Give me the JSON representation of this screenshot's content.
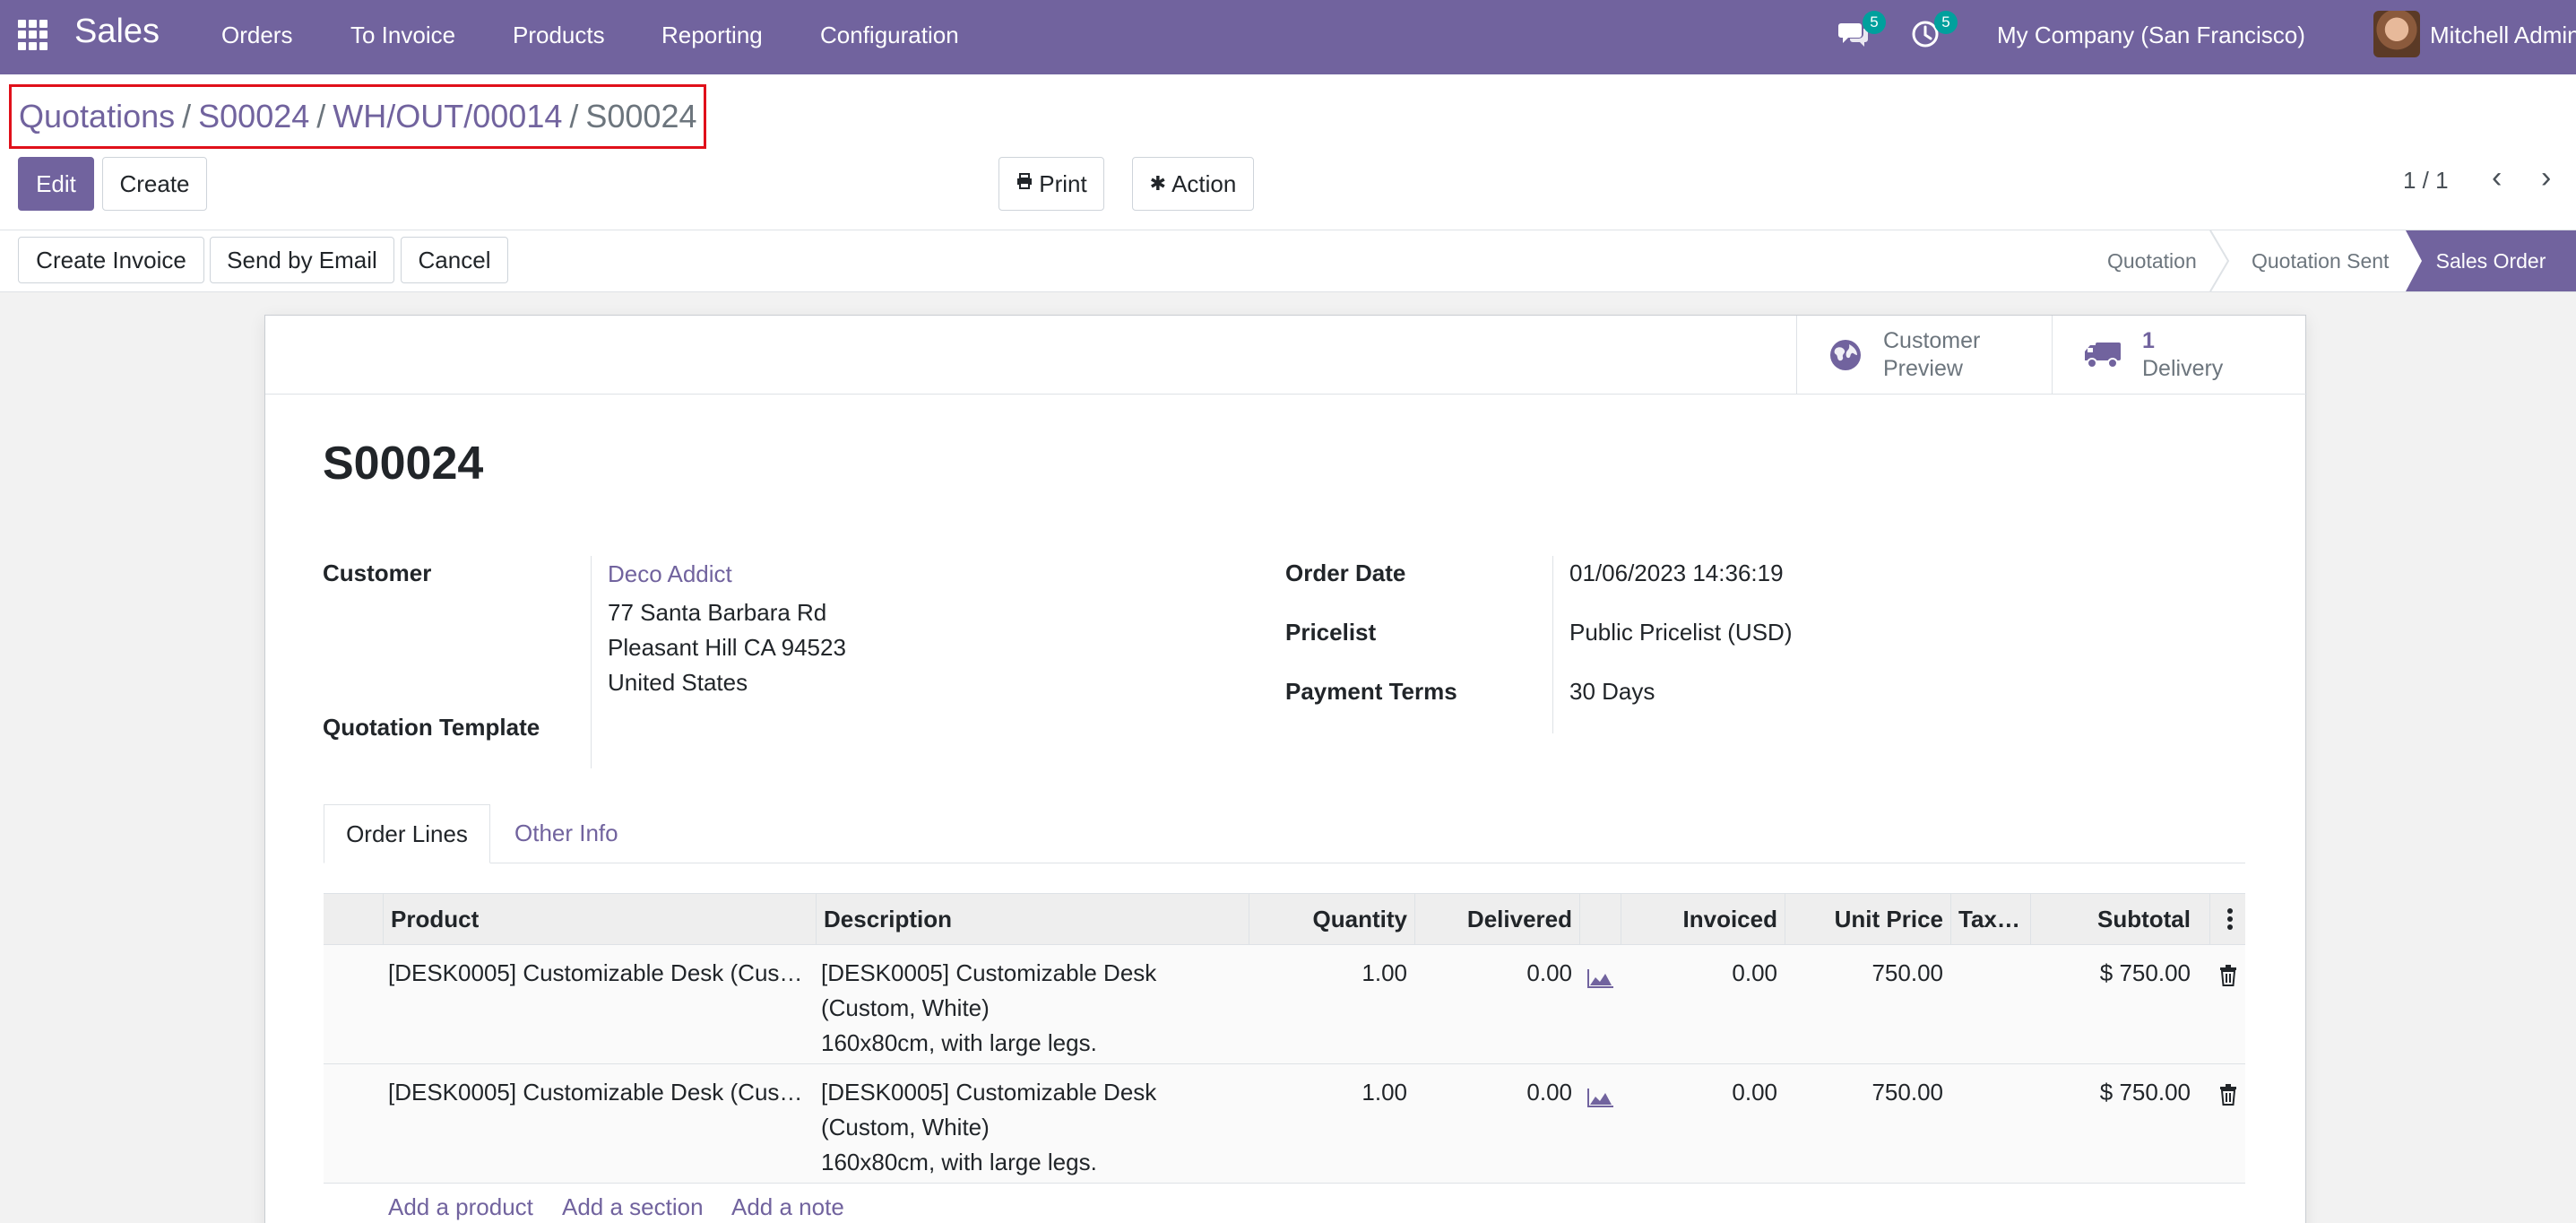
{
  "navbar": {
    "brand": "Sales",
    "menu": [
      "Orders",
      "To Invoice",
      "Products",
      "Reporting",
      "Configuration"
    ],
    "messages_badge": "5",
    "activities_badge": "5",
    "company": "My Company (San Francisco)",
    "user": "Mitchell Admin"
  },
  "breadcrumb": {
    "items": [
      "Quotations",
      "S00024",
      "WH/OUT/00014"
    ],
    "separator": "/",
    "current": "S00024"
  },
  "toolbar": {
    "edit_label": "Edit",
    "create_label": "Create",
    "print_label": "Print",
    "action_label": "Action",
    "pager": "1 / 1"
  },
  "statusbar": {
    "actions": [
      "Create Invoice",
      "Send by Email",
      "Cancel"
    ],
    "stages": [
      "Quotation",
      "Quotation Sent"
    ],
    "active_stage": "Sales Order"
  },
  "smart_buttons": {
    "preview_line1": "Customer",
    "preview_line2": "Preview",
    "delivery_count": "1",
    "delivery_label": "Delivery"
  },
  "form": {
    "title": "S00024",
    "customer_label": "Customer",
    "customer_name": "Deco Addict",
    "address_line1": "77 Santa Barbara Rd",
    "address_line2": "Pleasant Hill CA 94523",
    "address_line3": "United States",
    "template_label": "Quotation Template",
    "order_date_label": "Order Date",
    "order_date": "01/06/2023 14:36:19",
    "pricelist_label": "Pricelist",
    "pricelist": "Public Pricelist (USD)",
    "payment_terms_label": "Payment Terms",
    "payment_terms": "30 Days"
  },
  "tabs": {
    "active": "Order Lines",
    "other": "Other Info"
  },
  "table": {
    "headers": {
      "product": "Product",
      "description": "Description",
      "quantity": "Quantity",
      "delivered": "Delivered",
      "invoiced": "Invoiced",
      "unit_price": "Unit Price",
      "taxes": "Tax…",
      "subtotal": "Subtotal"
    },
    "rows": [
      {
        "product": "[DESK0005] Customizable Desk (Cus…",
        "desc1": "[DESK0005] Customizable Desk",
        "desc2": "(Custom, White)",
        "desc3": "160x80cm, with large legs.",
        "quantity": "1.00",
        "delivered": "0.00",
        "invoiced": "0.00",
        "unit_price": "750.00",
        "subtotal": "$ 750.00"
      },
      {
        "product": "[DESK0005] Customizable Desk (Cus…",
        "desc1": "[DESK0005] Customizable Desk",
        "desc2": "(Custom, White)",
        "desc3": "160x80cm, with large legs.",
        "quantity": "1.00",
        "delivered": "0.00",
        "invoiced": "0.00",
        "unit_price": "750.00",
        "subtotal": "$ 750.00"
      }
    ],
    "add_product": "Add a product",
    "add_section": "Add a section",
    "add_note": "Add a note"
  },
  "colors": {
    "brand": "#71639e",
    "badge": "#00a09d",
    "highlight_border": "#e0101a"
  }
}
